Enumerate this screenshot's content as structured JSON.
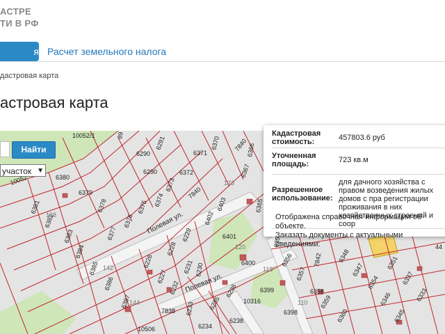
{
  "logo": {
    "line1": "АСТРЕ",
    "line2": "ТИ В РФ"
  },
  "nav": {
    "active_tab": "я карта",
    "tax_link": "Расчет земельного налога"
  },
  "breadcrumb": "дастровая карта",
  "page_title": "астровая карта",
  "map_controls": {
    "find_button": "Найти",
    "type_select": "участок"
  },
  "popup": {
    "rows": [
      {
        "label": "Кадастровая стоимость:",
        "value": "457803.6 руб"
      },
      {
        "label": "Уточненная площадь:",
        "value": "723 кв.м"
      },
      {
        "label": "Разрешенное использование:",
        "value": "для дачного хозяйства с правом возведения жилых домов с пра регистрации проживания в них хозяйственных строений и соор"
      }
    ],
    "note1": "Отображена справочная информация об объекте.",
    "note2": "Заказать документы с актуальными сведениями:"
  },
  "map_labels": {
    "p10052": "10052/1",
    "p89": "89",
    "p6291": "6291",
    "p6290a": "6290",
    "p6290b": "6290",
    "p6371": "6371",
    "p6372": "6372",
    "p6370": "6370",
    "p7840a": "7840",
    "p7840b": "7840",
    "p6366": "6366",
    "p6367": "6367",
    "p6373": "6373",
    "p6374": "6374",
    "p6375": "6375",
    "p6376": "6376",
    "p6377": "6377",
    "p6378": "6378",
    "p6379": "6379",
    "p6380": "6380",
    "p6381": "6381",
    "p6382": "6382",
    "p6383": "6383",
    "p6384": "6384",
    "p6385": "6385",
    "p6386": "6386",
    "p6387": "6387",
    "p6226": "6226",
    "p6227": "6227",
    "p6228": "6228",
    "p6229": "6229",
    "p6230": "6230",
    "p6231": "6231",
    "p6232": "6232",
    "p6233": "6233",
    "p6234": "6234",
    "p6235": "6235",
    "p6236": "6236",
    "p6238": "6238",
    "p6400": "6400",
    "p6401": "6401",
    "p6402": "6402",
    "p6403": "6403",
    "p6356": "6356",
    "p6357": "6357",
    "p6358": "6358",
    "p6359": "6359",
    "p6360": "6360",
    "p6398": "6398",
    "p6399": "6399",
    "p10316": "10316",
    "p7838": "7838",
    "p10506": "10506",
    "p6348": "6348",
    "p6347": "6347",
    "p6354": "6354",
    "p6346": "6346",
    "p6345": "6345",
    "p6351": "6351",
    "p6337": "6337",
    "p6333": "6333",
    "p7842": "7842",
    "p6365": "6365",
    "p6355": "6355",
    "p44": "44",
    "street1": "Полевая ул.",
    "street2": "Полевая ул.",
    "n10052b": "10052",
    "n123": "123",
    "n120": "120",
    "n142": "142",
    "n144": "144",
    "n138": "138",
    "n113": "113",
    "n110": "110"
  }
}
